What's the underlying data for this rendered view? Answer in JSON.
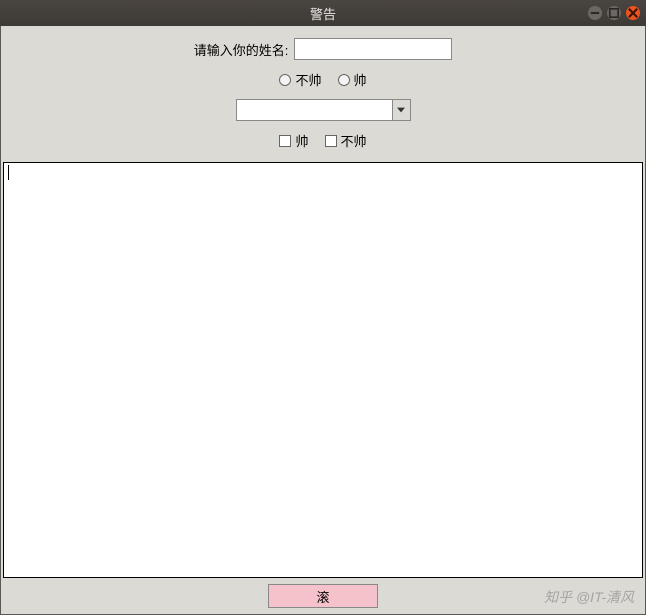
{
  "window": {
    "title": "警告"
  },
  "form": {
    "name_label": "请输入你的姓名:",
    "name_value": "",
    "radio1_label": "不帅",
    "radio2_label": "帅",
    "combo_value": "",
    "check1_label": "帅",
    "check2_label": "不帅"
  },
  "textarea": {
    "value": ""
  },
  "button": {
    "submit_label": "滚"
  },
  "watermark": "知乎 @IT-清风"
}
